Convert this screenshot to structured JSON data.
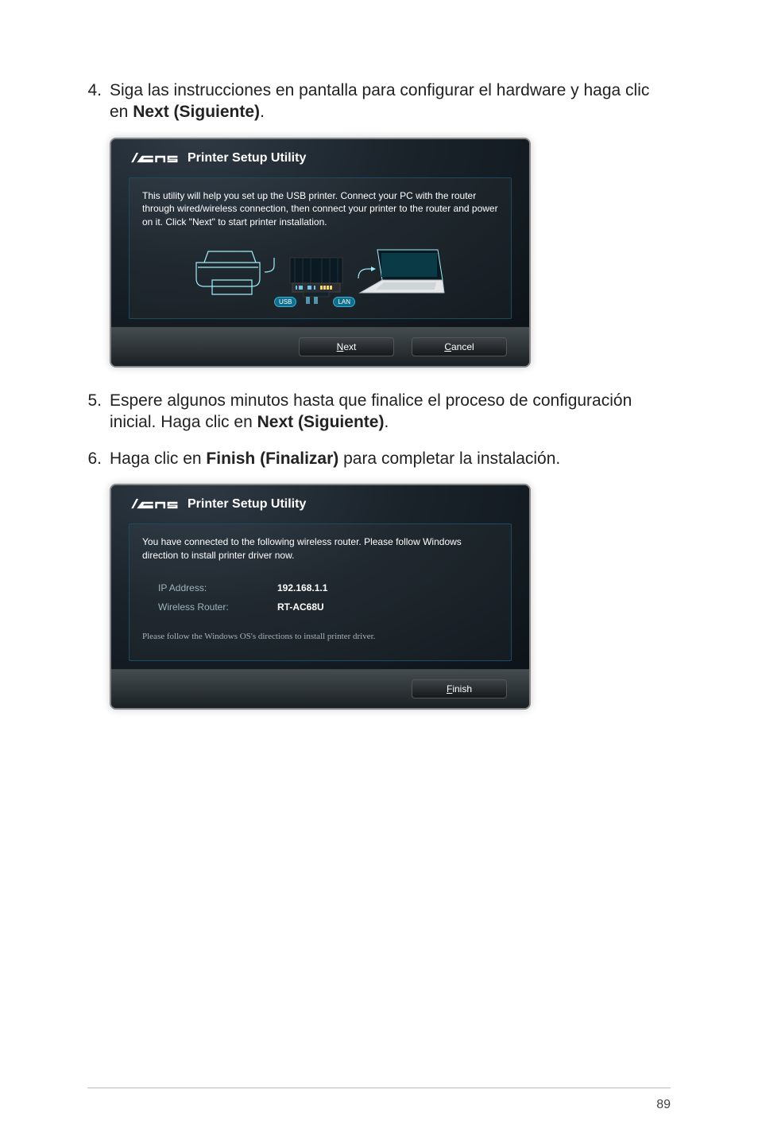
{
  "step4": {
    "num": "4.",
    "pre": "Siga las instrucciones en pantalla para configurar el hardware y haga clic en ",
    "bold": "Next (Siguiente)",
    "post": "."
  },
  "step5": {
    "num": "5.",
    "pre": "Espere algunos minutos hasta que finalice el proceso de configuración inicial. Haga clic en ",
    "bold": "Next (Siguiente)",
    "post": "."
  },
  "step6": {
    "num": "6.",
    "pre": "Haga clic en ",
    "bold": "Finish (Finalizar)",
    "post": " para completar la instalación."
  },
  "dialog1": {
    "title": "Printer Setup Utility",
    "desc": "This utility will help you set up the USB printer. Connect your PC with the router through wired/wireless connection, then connect your printer to the router and power on it. Click \"Next\" to start printer installation.",
    "usb_label": "USB",
    "lan_label": "LAN",
    "next_u": "N",
    "next_rest": "ext",
    "cancel_u": "C",
    "cancel_rest": "ancel"
  },
  "dialog2": {
    "title": "Printer Setup Utility",
    "desc": "You have connected to the following wireless router. Please follow Windows direction to install printer driver now.",
    "ip_label": "IP Address:",
    "ip_val": "192.168.1.1",
    "router_label": "Wireless Router:",
    "router_val": "RT-AC68U",
    "follow": "Please follow the Windows OS's directions to install printer driver.",
    "finish_u": "F",
    "finish_rest": "inish"
  },
  "page_number": "89"
}
